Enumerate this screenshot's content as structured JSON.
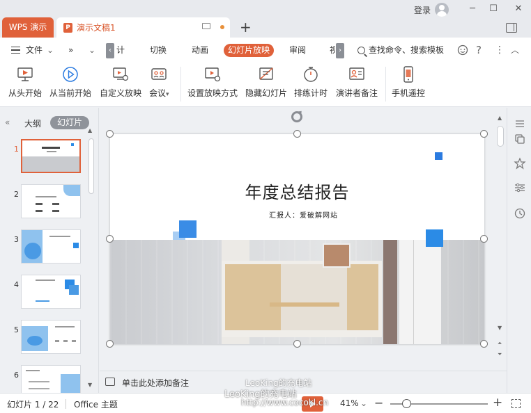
{
  "titlebar": {
    "login_label": "登录",
    "app_tab": "WPS 演示",
    "doc_tab": "演示文稿1",
    "doc_icon_letter": "P",
    "new_tab": "+",
    "minimize": "─",
    "maximize": "☐",
    "close": "✕"
  },
  "menu": {
    "file": "文件",
    "file_caret": "⌄",
    "more": "»",
    "qa_caret": "⌄",
    "scroll_left": "‹",
    "scroll_right": "›",
    "partial": "计",
    "items": [
      "切换",
      "动画",
      "幻灯片放映",
      "审阅"
    ],
    "partial_right": "视",
    "search": "查找命令、搜索模板",
    "help": "?",
    "more_dots": "⋮",
    "collapse": "︿"
  },
  "toolbar": {
    "items": [
      "从头开始",
      "从当前开始",
      "自定义放映",
      "会议",
      "设置放映方式",
      "隐藏幻灯片",
      "排练计时",
      "演讲者备注",
      "手机遥控"
    ],
    "meeting_caret": "▾"
  },
  "left_panel": {
    "collapse": "«",
    "outline_tab": "大纲",
    "slides_tab": "幻灯片",
    "thumb_numbers": [
      "1",
      "2",
      "3",
      "4",
      "5",
      "6"
    ]
  },
  "slide": {
    "title": "年度总结报告",
    "subtitle": "汇报人：爱破解网站"
  },
  "notes": {
    "placeholder": "单击此处添加备注"
  },
  "status": {
    "slide_position": "幻灯片 1 / 22",
    "theme": "Office 主题",
    "zoom": "41%",
    "zoom_caret": "⌄",
    "zoom_level": 0.41
  },
  "watermark": {
    "line1": "LeoKing的充电站",
    "line2": "LeoKing的充电站",
    "line3": "http://www.cocokl.cn"
  },
  "colors": {
    "accent": "#e0613a",
    "slide_blue": "#2b8be6"
  }
}
